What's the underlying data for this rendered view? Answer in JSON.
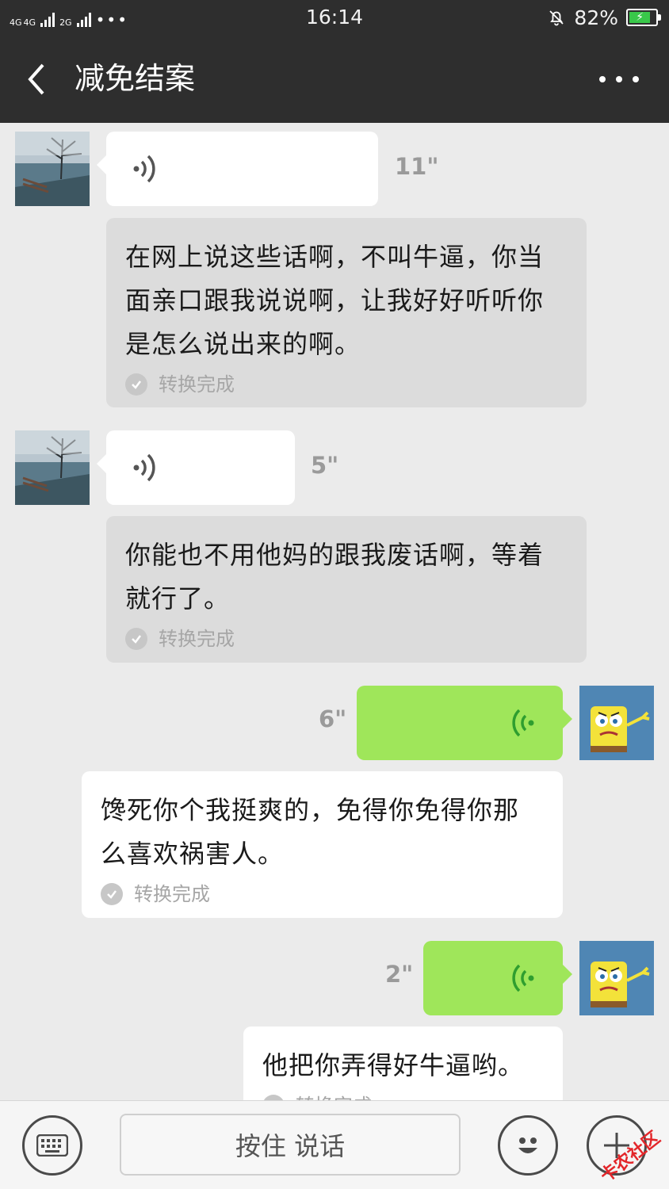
{
  "status_bar": {
    "network_1": "4G",
    "network_2": "4G",
    "network_3": "2G",
    "dots": "•••",
    "time": "16:14",
    "battery_percent": "82%",
    "battery_level": 0.82
  },
  "header": {
    "title": "减免结案",
    "back_icon": "chevron-left-icon",
    "more_icon": "more-dots-icon"
  },
  "messages": [
    {
      "direction": "in",
      "type": "voice",
      "duration": "11\"",
      "transcript": "在网上说这些话啊，不叫牛逼，你当面亲口跟我说说啊，让我好好听听你是怎么说出来的啊。",
      "status": "转换完成"
    },
    {
      "direction": "in",
      "type": "voice",
      "duration": "5\"",
      "transcript": "你能也不用他妈的跟我废话啊，等着就行了。",
      "status": "转换完成"
    },
    {
      "direction": "out",
      "type": "voice",
      "duration": "6\"",
      "transcript": "馋死你个我挺爽的，免得你免得你那么喜欢祸害人。",
      "status": "转换完成"
    },
    {
      "direction": "out",
      "type": "voice",
      "duration": "2\"",
      "transcript": "他把你弄得好牛逼哟。",
      "status": "转换完成"
    }
  ],
  "input_bar": {
    "talk_label": "按住 说话",
    "keyboard_icon": "keyboard-icon",
    "emoji_icon": "emoji-icon",
    "plus_icon": "plus-icon",
    "watermark": "卡农社区"
  },
  "colors": {
    "header_bg": "#2e2e2e",
    "chat_bg": "#ebebeb",
    "outgoing_bubble": "#9fe65a",
    "incoming_transcript": "#dcdcdc",
    "voice_wave_out": "#2f9e2f",
    "watermark": "#e3262a"
  }
}
